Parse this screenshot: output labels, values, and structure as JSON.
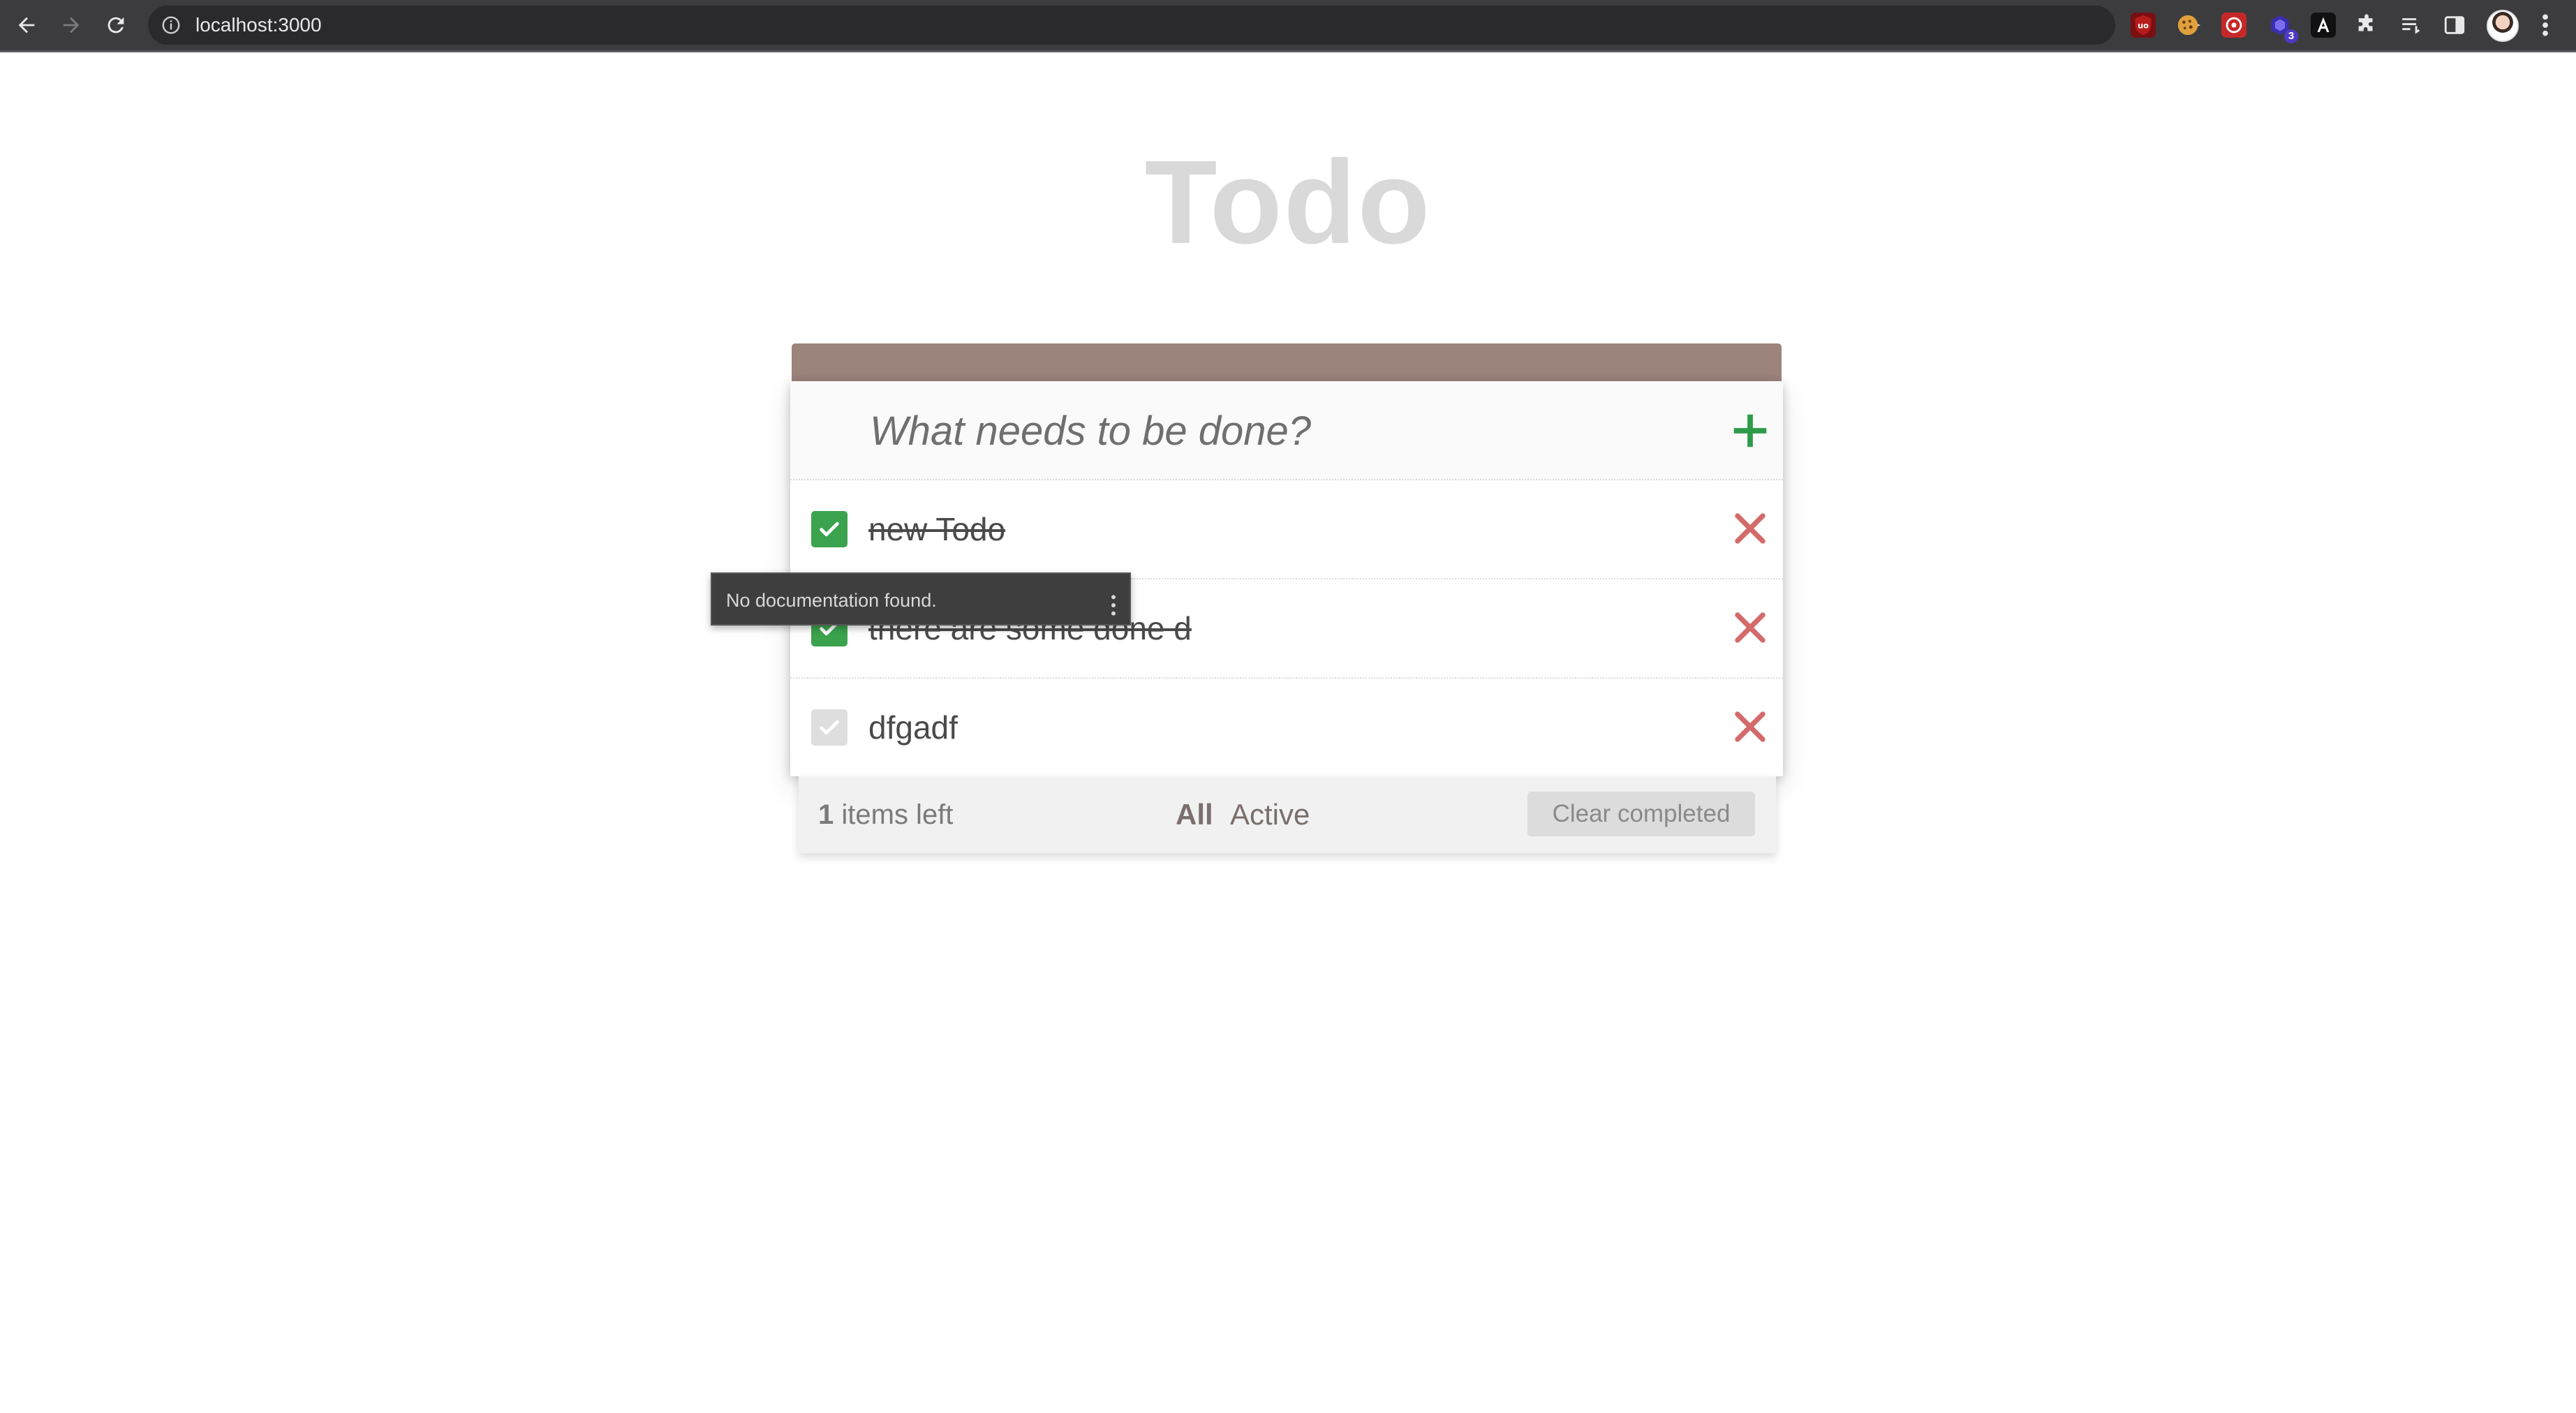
{
  "browser": {
    "url": "localhost:3000",
    "extension_badge": "3"
  },
  "app": {
    "title": "Todo"
  },
  "new_todo": {
    "placeholder": "What needs to be done?",
    "value": ""
  },
  "todos": [
    {
      "text": "new Todo",
      "completed": true
    },
    {
      "text": "there are some done d",
      "completed": true
    },
    {
      "text": "dfgadf",
      "completed": false
    }
  ],
  "footer": {
    "count": "1",
    "items_left_label": "items left",
    "filters": [
      {
        "label": "All",
        "selected": true
      },
      {
        "label": "Active",
        "selected": false
      }
    ],
    "clear_completed_label": "Clear completed"
  },
  "tooltip": {
    "text": "No documentation found."
  },
  "colors": {
    "header_bar": "#9c837c",
    "check_green": "#3ba34e",
    "add_green": "#2e9b4a",
    "delete_red": "#d46a6a",
    "title_gray": "#d9d9d9"
  }
}
